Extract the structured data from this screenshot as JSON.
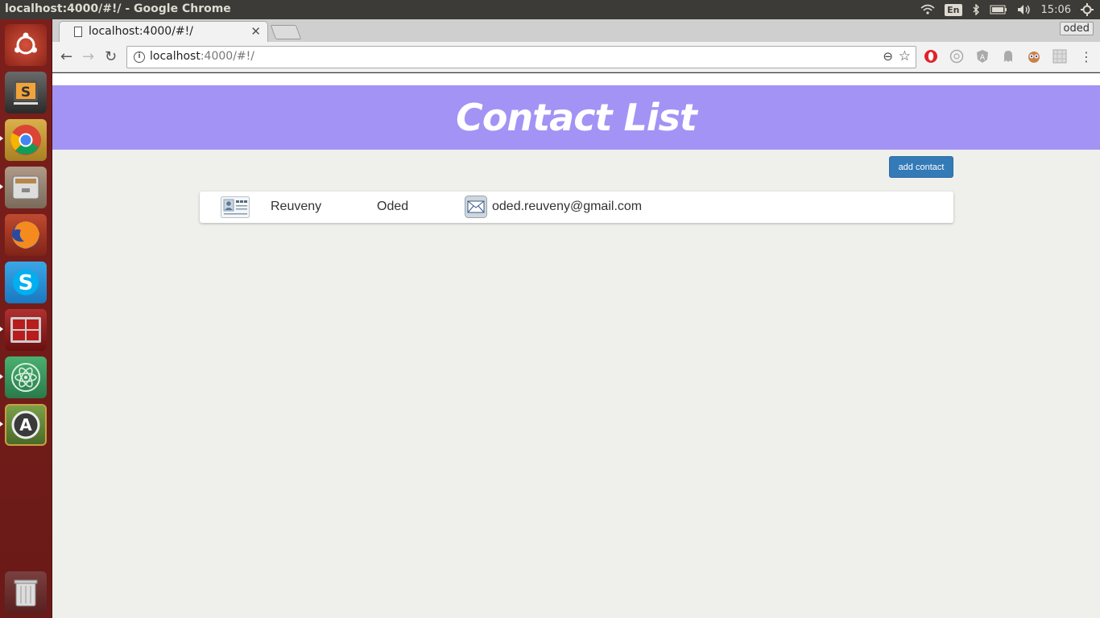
{
  "system": {
    "window_title": "localhost:4000/#!/ - Google Chrome",
    "lang": "En",
    "clock": "15:06"
  },
  "launcher": {
    "items": [
      {
        "name": "ubuntu-dash-icon",
        "color": "#b23a2c"
      },
      {
        "name": "sublime-text-icon",
        "color": "#4a4a4a"
      },
      {
        "name": "chrome-icon",
        "color": "#c89b2a"
      },
      {
        "name": "files-icon",
        "color": "#8a7a6a"
      },
      {
        "name": "firefox-icon",
        "color": "#a03020"
      },
      {
        "name": "skype-icon",
        "color": "#1a8fd6"
      },
      {
        "name": "terminal-icon",
        "color": "#8a1a1a"
      },
      {
        "name": "atom-icon",
        "color": "#3a8a5a"
      },
      {
        "name": "software-updater-icon",
        "color": "#5a7a3a"
      }
    ],
    "trash": {
      "name": "trash-icon"
    }
  },
  "browser": {
    "tab_title": "localhost:4000/#!/",
    "profile": "oded",
    "url_host": "localhost",
    "url_rest": ":4000/#!/"
  },
  "app": {
    "header_title": "Contact List",
    "add_button": "add contact",
    "contacts": [
      {
        "last_name": "Reuveny",
        "first_name": "Oded",
        "email": "oded.reuveny@gmail.com"
      }
    ]
  },
  "colors": {
    "header": "#a393f5",
    "button": "#337ab7",
    "page_bg": "#eff0eb"
  }
}
